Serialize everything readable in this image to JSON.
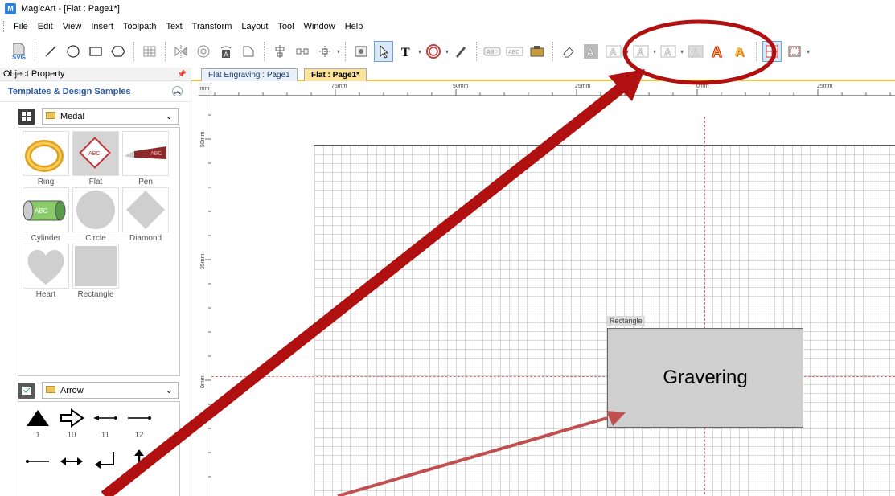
{
  "window": {
    "title": "MagicArt - [Flat : Page1*]",
    "app_icon": "magicart-icon"
  },
  "menu": [
    "File",
    "Edit",
    "View",
    "Insert",
    "Toolpath",
    "Text",
    "Transform",
    "Layout",
    "Tool",
    "Window",
    "Help"
  ],
  "toolbar": {
    "icons": [
      "svg-import-icon",
      "line-tool-icon",
      "circle-tool-icon",
      "rectangle-tool-icon",
      "polygon-tool-icon",
      "table-icon",
      "mirror-icon",
      "rotate-icon",
      "text-frame-icon",
      "crop-icon",
      "align-icon",
      "distribute-icon",
      "arrange-icon",
      "image-icon",
      "select-arrow-icon",
      "text-tool-icon",
      "ring-icon",
      "pen-icon",
      "text-effect-icon",
      "text-path-icon",
      "photo-icon",
      "eraser-icon",
      "outline-a-icon",
      "outline-a-icon-2",
      "outline-a-icon-3",
      "outline-a-icon-4",
      "outline-a-icon-5",
      "colored-a-icon",
      "shadow-a-icon",
      "snap-grid-icon",
      "frame-icon"
    ],
    "svg_label": "SVG"
  },
  "left_panel": {
    "header": "Object Property",
    "templates_title": "Templates & Design Samples",
    "medal_dropdown": "Medal",
    "medal_items": [
      "Ring",
      "Flat",
      "Pen",
      "Cylinder",
      "Circle",
      "Diamond",
      "Heart",
      "Rectangle"
    ],
    "medal_thumb_text": "ABC",
    "arrow_dropdown": "Arrow",
    "arrow_items": [
      "1",
      "10",
      "11",
      "12"
    ]
  },
  "tabs": [
    "Flat Engraving : Page1",
    "Flat : Page1*"
  ],
  "ruler": {
    "h_labels": [
      "75mm",
      "50mm",
      "25mm",
      "0mm",
      "25mm"
    ],
    "v_labels": [
      "50mm",
      "25mm",
      "0mm"
    ],
    "corner": "mm"
  },
  "canvas": {
    "shape_tag": "Rectangle",
    "shape_text": "Gravering"
  },
  "colors": {
    "annotation_red": "#b01010",
    "accent_tab": "#f0c040",
    "link_blue": "#2a58a3"
  }
}
